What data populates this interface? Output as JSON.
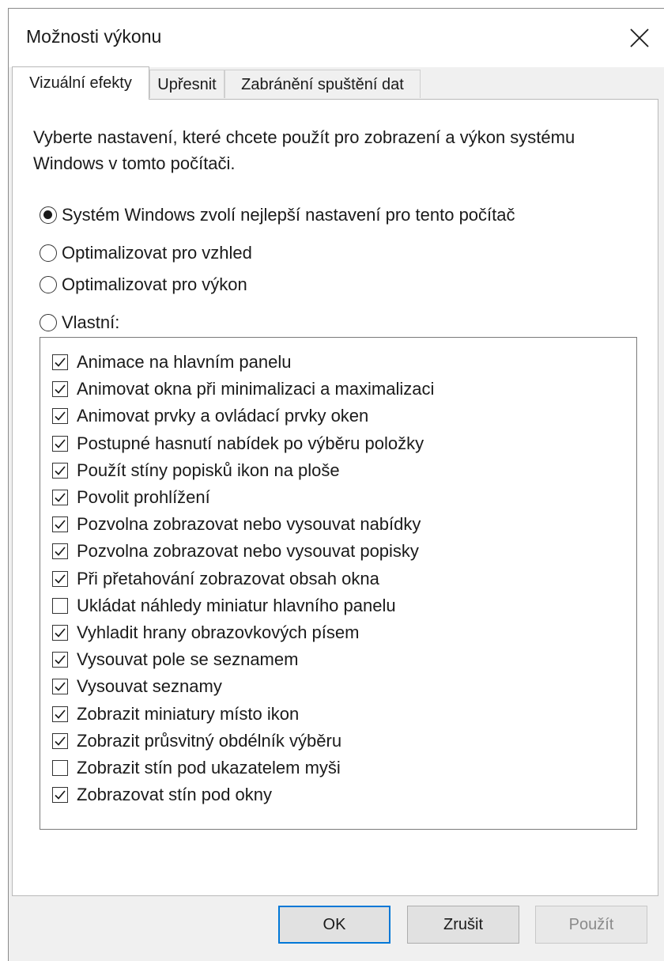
{
  "window": {
    "title": "Možnosti výkonu",
    "close_icon": "close-icon"
  },
  "tabs": [
    {
      "label": "Vizuální efekty",
      "active": true
    },
    {
      "label": "Upřesnit",
      "active": false
    },
    {
      "label": "Zabránění spuštění dat",
      "active": false
    }
  ],
  "description": "Vyberte nastavení, které chcete použít pro zobrazení a výkon systému Windows v tomto počítači.",
  "radios": [
    {
      "label": "Systém Windows zvolí nejlepší nastavení pro tento počítač",
      "checked": true
    },
    {
      "label": "Optimalizovat pro vzhled",
      "checked": false
    },
    {
      "label": "Optimalizovat pro výkon",
      "checked": false
    },
    {
      "label": "Vlastní:",
      "checked": false
    }
  ],
  "effects": [
    {
      "label": "Animace na hlavním panelu",
      "checked": true
    },
    {
      "label": "Animovat okna při minimalizaci a maximalizaci",
      "checked": true
    },
    {
      "label": "Animovat prvky a ovládací prvky oken",
      "checked": true
    },
    {
      "label": "Postupné hasnutí nabídek po výběru položky",
      "checked": true
    },
    {
      "label": "Použít stíny popisků ikon na ploše",
      "checked": true
    },
    {
      "label": "Povolit prohlížení",
      "checked": true
    },
    {
      "label": "Pozvolna zobrazovat nebo vysouvat nabídky",
      "checked": true
    },
    {
      "label": "Pozvolna zobrazovat nebo vysouvat popisky",
      "checked": true
    },
    {
      "label": "Při přetahování zobrazovat obsah okna",
      "checked": true
    },
    {
      "label": "Ukládat náhledy miniatur hlavního panelu",
      "checked": false
    },
    {
      "label": "Vyhladit hrany obrazovkových písem",
      "checked": true
    },
    {
      "label": "Vysouvat pole se seznamem",
      "checked": true
    },
    {
      "label": "Vysouvat seznamy",
      "checked": true
    },
    {
      "label": "Zobrazit miniatury místo ikon",
      "checked": true
    },
    {
      "label": "Zobrazit průsvitný obdélník výběru",
      "checked": true
    },
    {
      "label": "Zobrazit stín pod ukazatelem myši",
      "checked": false
    },
    {
      "label": "Zobrazovat stín pod okny",
      "checked": true
    }
  ],
  "buttons": {
    "ok": "OK",
    "cancel": "Zrušit",
    "apply": "Použít",
    "apply_enabled": false
  },
  "colors": {
    "focus_border": "#0078d7",
    "disabled_text": "#8a8a8a"
  }
}
